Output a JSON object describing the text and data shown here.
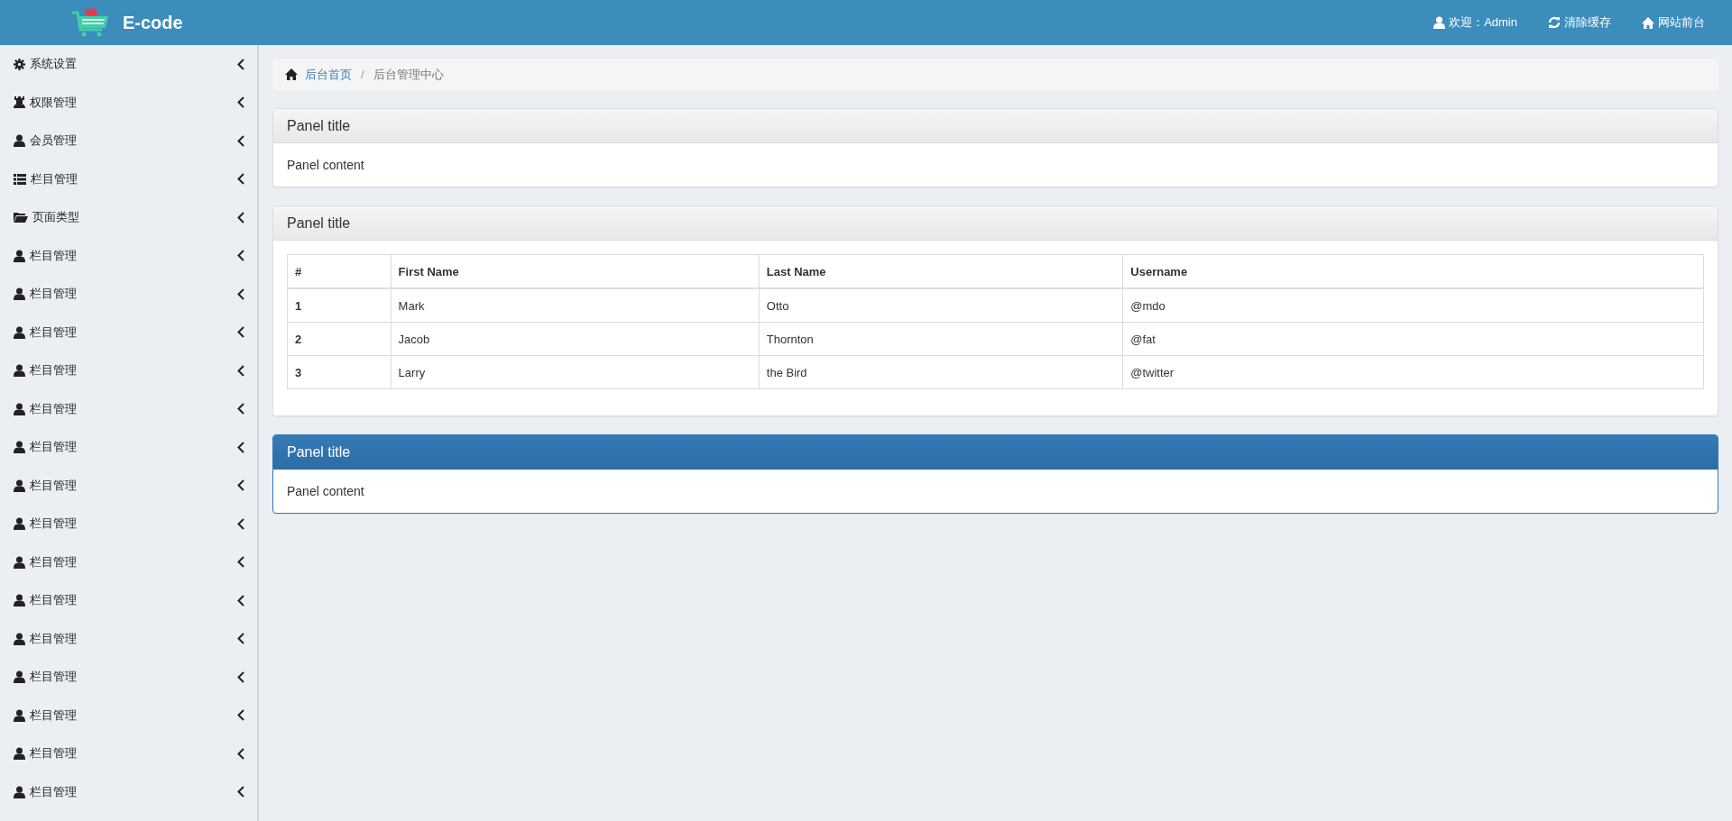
{
  "header": {
    "brand": "E-code",
    "links": [
      {
        "kind": "user",
        "label": "欢迎：Admin"
      },
      {
        "kind": "refresh",
        "label": "清除缓存"
      },
      {
        "kind": "home",
        "label": "网站前台"
      }
    ]
  },
  "sidebar": {
    "items": [
      {
        "kind": "gear",
        "label": "系统设置",
        "expanded": false
      },
      {
        "kind": "rook",
        "label": "权限管理",
        "expanded": false
      },
      {
        "kind": "user",
        "label": "会员管理",
        "expanded": false
      },
      {
        "kind": "list",
        "label": "栏目管理",
        "expanded": false
      },
      {
        "kind": "folder",
        "label": "页面类型",
        "expanded": false
      },
      {
        "kind": "user",
        "label": "栏目管理",
        "expanded": false
      },
      {
        "kind": "user",
        "label": "栏目管理",
        "expanded": false
      },
      {
        "kind": "user",
        "label": "栏目管理",
        "expanded": false
      },
      {
        "kind": "user",
        "label": "栏目管理",
        "expanded": false
      },
      {
        "kind": "user",
        "label": "栏目管理",
        "expanded": false
      },
      {
        "kind": "user",
        "label": "栏目管理",
        "expanded": false
      },
      {
        "kind": "user",
        "label": "栏目管理",
        "expanded": false
      },
      {
        "kind": "user",
        "label": "栏目管理",
        "expanded": false
      },
      {
        "kind": "user",
        "label": "栏目管理",
        "expanded": false
      },
      {
        "kind": "user",
        "label": "栏目管理",
        "expanded": false
      },
      {
        "kind": "user",
        "label": "栏目管理",
        "expanded": false
      },
      {
        "kind": "user",
        "label": "栏目管理",
        "expanded": false
      },
      {
        "kind": "user",
        "label": "栏目管理",
        "expanded": false
      },
      {
        "kind": "user",
        "label": "栏目管理",
        "expanded": false
      },
      {
        "kind": "user",
        "label": "栏目管理",
        "expanded": false
      }
    ]
  },
  "breadcrumb": {
    "separator": "/",
    "items": [
      {
        "label": "后台首页",
        "link": true
      },
      {
        "label": "后台管理中心",
        "link": false
      }
    ]
  },
  "panels": [
    {
      "kind": "default",
      "title": "Panel title",
      "content": "Panel content"
    },
    {
      "kind": "default",
      "title": "Panel title",
      "table": {
        "columns": [
          "#",
          "First Name",
          "Last Name",
          "Username"
        ],
        "rows": [
          [
            "1",
            "Mark",
            "Otto",
            "@mdo"
          ],
          [
            "2",
            "Jacob",
            "Thornton",
            "@fat"
          ],
          [
            "3",
            "Larry",
            "the Bird",
            "@twitter"
          ]
        ]
      }
    },
    {
      "kind": "primary",
      "title": "Panel title",
      "content": "Panel content"
    }
  ]
}
